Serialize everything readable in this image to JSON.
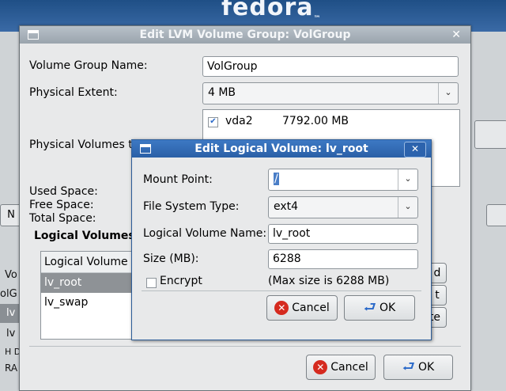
{
  "background": {
    "brand": "fedora",
    "brand_tm": "™",
    "left_labels": [
      "Vo",
      "olG",
      "lv",
      "lv",
      "H Dr",
      "RA"
    ],
    "left_button": "N",
    "right_buttons": [
      "d",
      "t",
      "te"
    ]
  },
  "lvm_dialog": {
    "title": "Edit LVM Volume Group: VolGroup",
    "volume_group_name_label": "Volume Group Name:",
    "volume_group_name_value": "VolGroup",
    "physical_extent_label": "Physical Extent:",
    "physical_extent_value": "4 MB",
    "physical_volumes_label": "Physical Volumes to",
    "physical_volumes": [
      {
        "name": "vda2",
        "size": "7792.00 MB",
        "checked": true
      }
    ],
    "used_space_label": "Used Space:",
    "free_space_label": "Free Space:",
    "total_space_label": "Total Space:",
    "logical_volumes_label": "Logical Volumes",
    "lv_list_header": "Logical Volume N",
    "lv_items": [
      "lv_root",
      "lv_swap"
    ],
    "cancel_label": "Cancel",
    "ok_label": "OK"
  },
  "edit_lv_dialog": {
    "title": "Edit Logical Volume: lv_root",
    "mount_point_label": "Mount Point:",
    "mount_point_value": "/",
    "fs_type_label": "File System Type:",
    "fs_type_value": "ext4",
    "lv_name_label": "Logical Volume Name:",
    "lv_name_value": "lv_root",
    "size_label": "Size (MB):",
    "size_value": "6288",
    "encrypt_label": "Encrypt",
    "encrypt_checked": false,
    "max_size_note": "(Max size is 6288 MB)",
    "cancel_label": "Cancel",
    "ok_label": "OK"
  }
}
